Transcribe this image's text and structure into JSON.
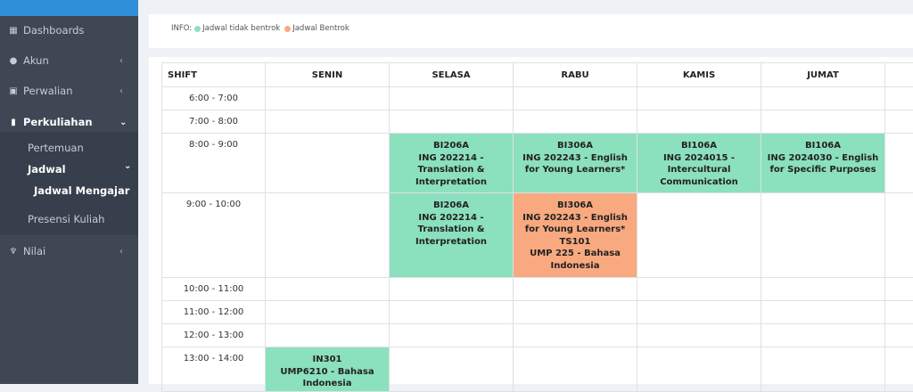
{
  "sidebar": {
    "items": [
      {
        "label": "Dashboards",
        "icon": "grid-icon",
        "chevron": ""
      },
      {
        "label": "Akun",
        "icon": "user-icon",
        "chevron": "‹"
      },
      {
        "label": "Perwalian",
        "icon": "id-card-icon",
        "chevron": "‹"
      },
      {
        "label": "Perkuliahan",
        "icon": "book-icon",
        "chevron": "⌄"
      },
      {
        "label": "Nilai",
        "icon": "trophy-icon",
        "chevron": "‹"
      }
    ],
    "sub_items": {
      "pertemuan": "Pertemuan",
      "jadwal": "Jadwal",
      "jadwal_chevron": "⌄",
      "jadwal_mengajar": "Jadwal Mengajar",
      "presensi": "Presensi Kuliah"
    }
  },
  "info": {
    "prefix": "INFO:",
    "no_conflict_label": "Jadwal tidak bentrok",
    "conflict_label": "Jadwal Bentrok",
    "no_conflict_color": "#8be0be",
    "conflict_color": "#f9a97f"
  },
  "schedule": {
    "headers": [
      "SHIFT",
      "SENIN",
      "SELASA",
      "RABU",
      "KAMIS",
      "JUMAT",
      ""
    ],
    "rows": [
      {
        "time": "6:00 - 7:00"
      },
      {
        "time": "7:00 - 8:00"
      },
      {
        "time": "8:00 - 9:00",
        "selasa": [
          "BI206A",
          "ING 202214 - Translation & Interpretation"
        ],
        "rabu": [
          "BI306A",
          "ING 202243 - English for Young Learners*"
        ],
        "kamis": [
          "BI106A",
          "ING 2024015 - Intercultural Communication"
        ],
        "jumat": [
          "BI106A",
          "ING 2024030 - English for Specific Purposes"
        ]
      },
      {
        "time": "9:00 - 10:00",
        "selasa": [
          "BI206A",
          "ING 202214 - Translation & Interpretation"
        ],
        "rabu": [
          "BI306A",
          "ING 202243 - English for Young Learners*",
          "TS101",
          "UMP 225 - Bahasa Indonesia"
        ]
      },
      {
        "time": "10:00 - 11:00"
      },
      {
        "time": "11:00 - 12:00"
      },
      {
        "time": "12:00 - 13:00"
      },
      {
        "time": "13:00 - 14:00",
        "senin": [
          "IN301",
          "UMP6210 - Bahasa Indonesia"
        ]
      }
    ]
  }
}
